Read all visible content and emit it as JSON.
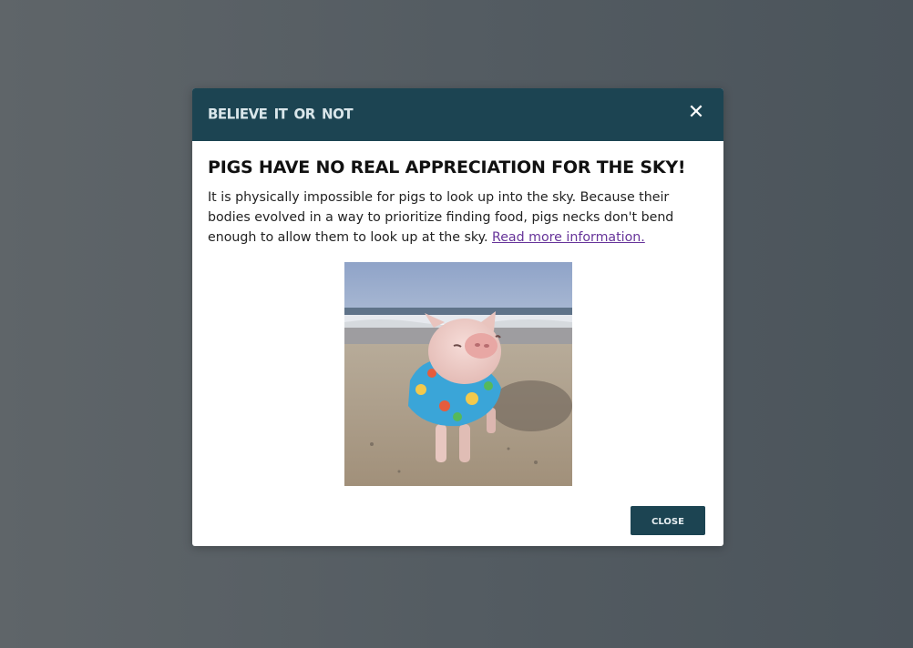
{
  "modal": {
    "title": "Believe it or not",
    "close_icon": "close-icon",
    "headline": "PIGS HAVE NO REAL APPRECIATION FOR THE SKY!",
    "body_text": "It is physically impossible for pigs to look up into the sky. Because their bodies evolved in a way to prioritize finding food, pigs necks don't bend enough to allow them to look up at the sky. ",
    "link_text": "Read more information.",
    "image": "photo of a pig in a floral shirt on a beach",
    "close_button_label": "close"
  },
  "colors": {
    "header_bg": "#1c4452",
    "title_text": "#d9e6ea",
    "link": "#663399",
    "button_bg": "#1c4452"
  }
}
